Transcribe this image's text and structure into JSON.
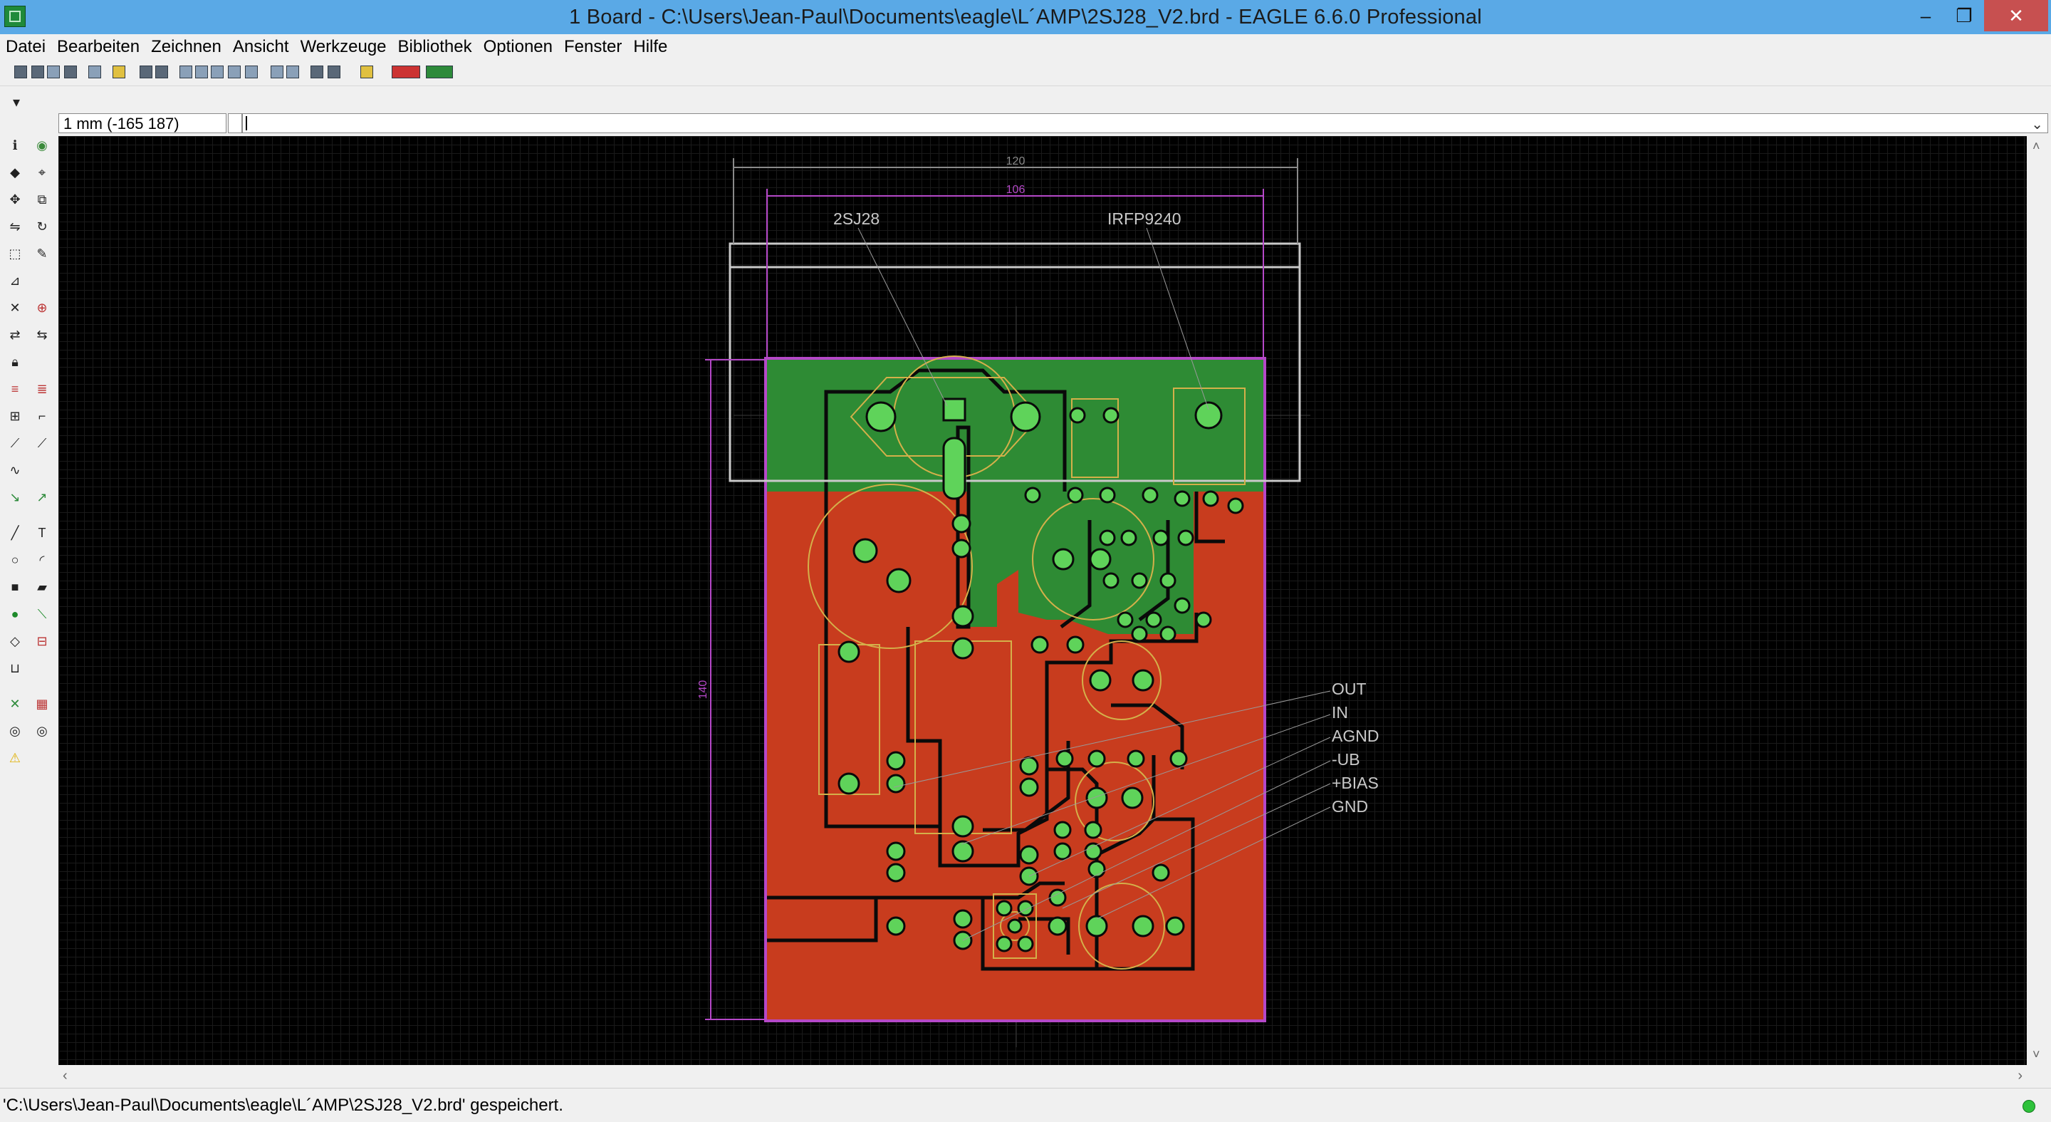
{
  "window": {
    "title": "1 Board - C:\\Users\\Jean-Paul\\Documents\\eagle\\L´AMP\\2SJ28_V2.brd - EAGLE 6.6.0 Professional",
    "min_glyph": "–",
    "max_glyph": "❐",
    "close_glyph": "✕"
  },
  "menu": [
    "Datei",
    "Bearbeiten",
    "Zeichnen",
    "Ansicht",
    "Werkzeuge",
    "Bibliothek",
    "Optionen",
    "Fenster",
    "Hilfe"
  ],
  "coord_display": "1 mm (-165 187)",
  "layer_dropdown_glyph": "▾",
  "cmd_dropdown_glyph": "⌄",
  "board": {
    "dim_top": "120",
    "dim_inner": "106",
    "dim_left": "140",
    "component_labels": [
      "2SJ28",
      "IRFP9240"
    ],
    "net_labels": [
      "OUT",
      "IN",
      "AGND",
      "-UB",
      "+BIAS",
      "GND"
    ]
  },
  "colors": {
    "canvas": "#000000",
    "top_copper": "#c83c1e",
    "bottom_copper": "#2e8b34",
    "outline": "#b548c8",
    "silkscreen": "#d4b04a",
    "pad": "#5fd35a",
    "dimension": "#c9c9c9"
  },
  "status_message": "'C:\\Users\\Jean-Paul\\Documents\\eagle\\L´AMP\\2SJ28_V2.brd' gespeichert."
}
